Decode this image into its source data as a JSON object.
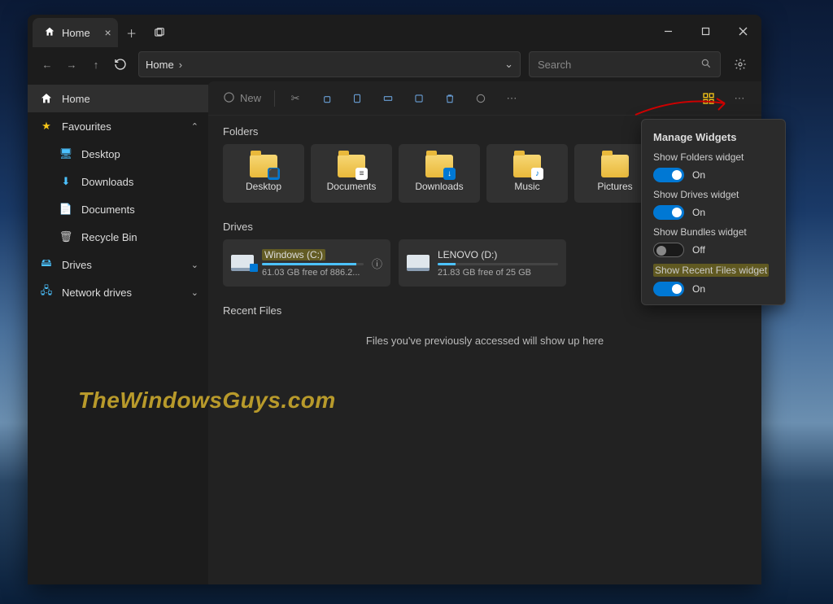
{
  "titlebar": {
    "tab_label": "Home"
  },
  "nav": {
    "path": "Home",
    "search_placeholder": "Search"
  },
  "sidebar": {
    "home": "Home",
    "favourites": "Favourites",
    "fav_items": [
      "Desktop",
      "Downloads",
      "Documents",
      "Recycle Bin"
    ],
    "drives": "Drives",
    "network": "Network drives"
  },
  "toolbar": {
    "new": "New"
  },
  "sections": {
    "folders": "Folders",
    "drives": "Drives",
    "recent": "Recent Files"
  },
  "folders": [
    "Desktop",
    "Documents",
    "Downloads",
    "Music",
    "Pictures"
  ],
  "drives": [
    {
      "name": "Windows (C:)",
      "free": "61.03 GB free of 886.2...",
      "pct": 93,
      "highlight": true,
      "win": true,
      "info": true
    },
    {
      "name": "LENOVO (D:)",
      "free": "21.83 GB free of 25 GB",
      "pct": 15,
      "highlight": false,
      "win": false,
      "info": false
    }
  ],
  "recent_empty": "Files you've previously accessed will show up here",
  "watermark": "TheWindowsGuys.com",
  "popup": {
    "title": "Manage Widgets",
    "rows": [
      {
        "label": "Show Folders widget",
        "on": true,
        "val": "On"
      },
      {
        "label": "Show Drives widget",
        "on": true,
        "val": "On"
      },
      {
        "label": "Show Bundles widget",
        "on": false,
        "val": "Off"
      },
      {
        "label": "Show Recent Files widget",
        "on": true,
        "val": "On",
        "highlight": true
      }
    ]
  }
}
